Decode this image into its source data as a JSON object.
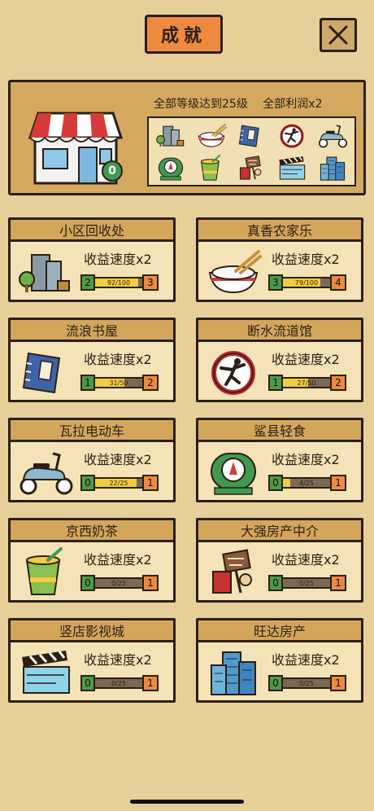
{
  "header": {
    "title": "成就",
    "close_label": "✕"
  },
  "summary": {
    "goal_text": "全部等级达到25级",
    "reward_text": "全部利润x2",
    "shop_level": "0",
    "icons": [
      "building-icon",
      "rice-bowl-icon",
      "book-icon",
      "karate-icon",
      "scooter-icon",
      "tea-badge-icon",
      "milk-tea-icon",
      "agency-icon",
      "clapper-icon",
      "tower-icon"
    ]
  },
  "cards": [
    {
      "name": "小区回收处",
      "speed": "收益速度x2",
      "level": "2",
      "progress": "92/100",
      "fill": 0.92,
      "next": "3",
      "icon": "building-icon"
    },
    {
      "name": "真香农家乐",
      "speed": "收益速度x2",
      "level": "3",
      "progress": "79/100",
      "fill": 0.79,
      "next": "4",
      "icon": "rice-bowl-icon"
    },
    {
      "name": "流浪书屋",
      "speed": "收益速度x2",
      "level": "1",
      "progress": "31/50",
      "fill": 0.62,
      "next": "2",
      "icon": "book-icon"
    },
    {
      "name": "断水流道馆",
      "speed": "收益速度x2",
      "level": "1",
      "progress": "27/50",
      "fill": 0.54,
      "next": "2",
      "icon": "karate-icon"
    },
    {
      "name": "瓦拉电动车",
      "speed": "收益速度x2",
      "level": "0",
      "progress": "22/25",
      "fill": 0.88,
      "next": "1",
      "icon": "scooter-icon"
    },
    {
      "name": "鲨县轻食",
      "speed": "收益速度x2",
      "level": "0",
      "progress": "4/25",
      "fill": 0.16,
      "next": "1",
      "icon": "tea-badge-icon"
    },
    {
      "name": "京西奶茶",
      "speed": "收益速度x2",
      "level": "0",
      "progress": "0/25",
      "fill": 0,
      "next": "1",
      "icon": "milk-tea-icon"
    },
    {
      "name": "大强房产中介",
      "speed": "收益速度x2",
      "level": "0",
      "progress": "0/25",
      "fill": 0,
      "next": "1",
      "icon": "agency-icon"
    },
    {
      "name": "竖店影视城",
      "speed": "收益速度x2",
      "level": "0",
      "progress": "0/25",
      "fill": 0,
      "next": "1",
      "icon": "clapper-icon"
    },
    {
      "name": "旺达房产",
      "speed": "收益速度x2",
      "level": "0",
      "progress": "0/25",
      "fill": 0,
      "next": "1",
      "icon": "tower-icon"
    }
  ]
}
